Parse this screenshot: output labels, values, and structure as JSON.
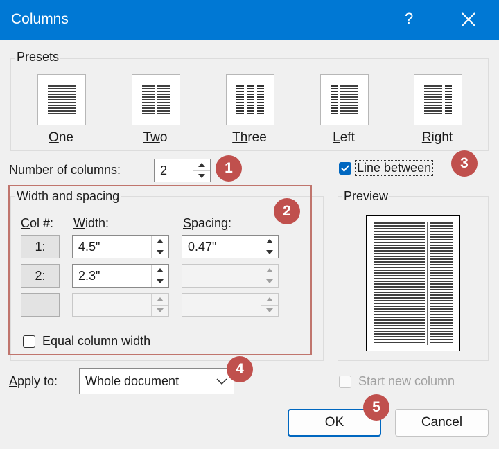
{
  "window": {
    "title": "Columns",
    "help_label": "?"
  },
  "presets": {
    "legend": "Presets",
    "items": [
      {
        "label": "One",
        "accel": "O",
        "rest": "ne",
        "icon": "one-column-preset-icon"
      },
      {
        "label": "Two",
        "accel": "Tw",
        "rest": "o",
        "icon": "two-columns-preset-icon"
      },
      {
        "label": "Three",
        "accel": "Th",
        "rest": "ree",
        "icon": "three-columns-preset-icon"
      },
      {
        "label": "Left",
        "accel": "L",
        "rest": "eft",
        "icon": "left-columns-preset-icon"
      },
      {
        "label": "Right",
        "accel": "R",
        "rest": "ight",
        "icon": "right-columns-preset-icon"
      }
    ]
  },
  "num_columns": {
    "label_accel": "N",
    "label_rest": "umber of columns:",
    "value": "2"
  },
  "line_between": {
    "label": "Line between",
    "checked": true
  },
  "width_spacing": {
    "legend": "Width and spacing",
    "col_header": "Col #:",
    "col_header_accel": "C",
    "col_header_rest": "ol #:",
    "width_header_accel": "W",
    "width_header_rest": "idth:",
    "spacing_header_accel": "S",
    "spacing_header_rest": "pacing:",
    "rows": [
      {
        "col": "1:",
        "width": "4.5\"",
        "spacing": "0.47\""
      },
      {
        "col": "2:",
        "width": "2.3\"",
        "spacing": ""
      },
      {
        "col": "",
        "width": "",
        "spacing": ""
      }
    ],
    "equal_width": {
      "accel": "E",
      "rest": "qual column width",
      "checked": false
    }
  },
  "preview": {
    "legend": "Preview"
  },
  "apply_to": {
    "label_accel": "A",
    "label_rest": "pply to:",
    "value": "Whole document"
  },
  "start_new_column": {
    "label": "Start new column",
    "checked": false
  },
  "buttons": {
    "ok": "OK",
    "cancel": "Cancel"
  },
  "badges": [
    "1",
    "2",
    "3",
    "4",
    "5"
  ],
  "colors": {
    "title_bar": "#0078d4",
    "badge": "#c0504d",
    "accent": "#0067c0"
  }
}
